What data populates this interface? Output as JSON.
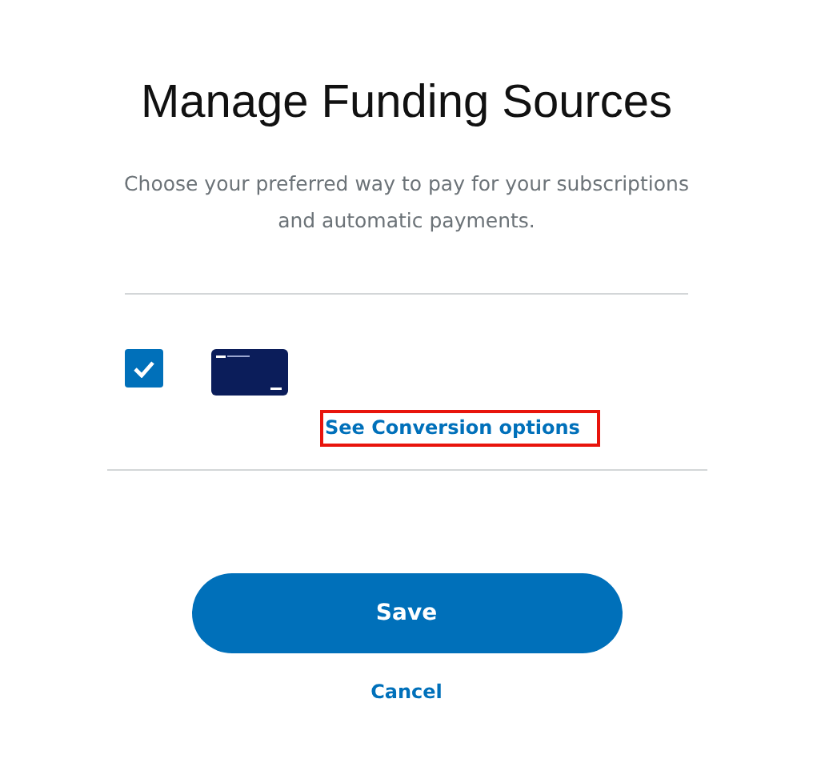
{
  "title": "Manage Funding Sources",
  "description": "Choose your preferred way to pay for your subscriptions and automatic payments.",
  "funding_sources": [
    {
      "checked": true,
      "link": "See Conversion options",
      "highlighted": true
    }
  ],
  "buttons": [
    {
      "kind": "primary",
      "label": "Save"
    },
    {
      "kind": "link",
      "label": "Cancel"
    }
  ]
}
